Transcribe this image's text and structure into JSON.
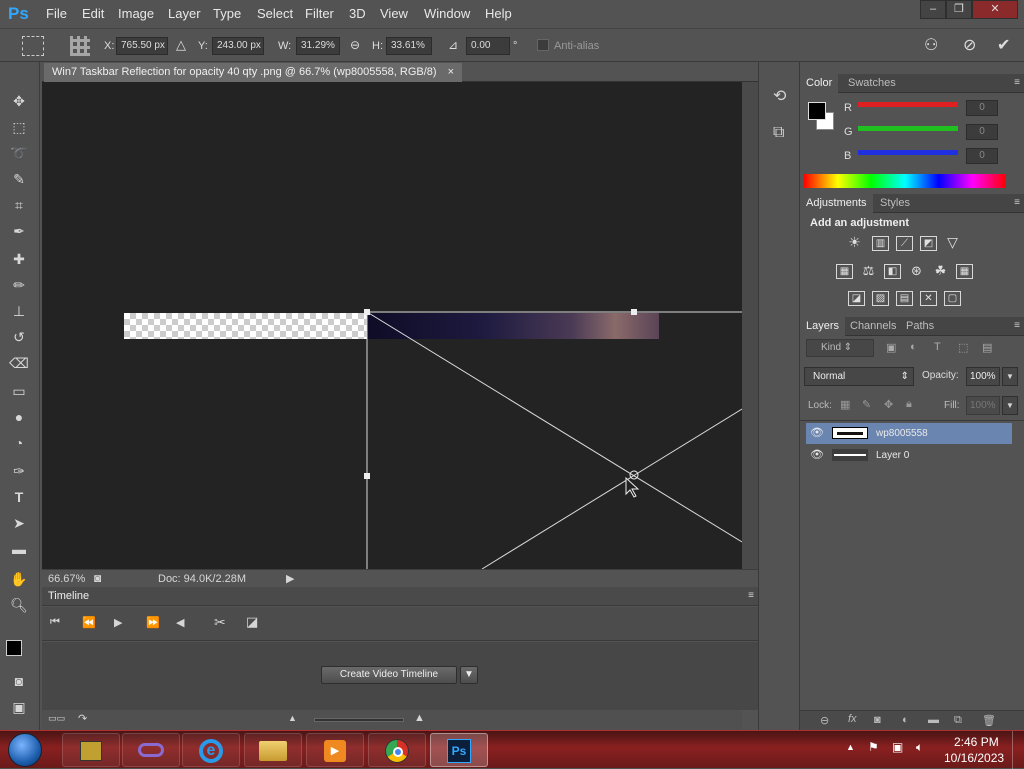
{
  "app": {
    "logo": "Ps"
  },
  "menu": [
    "File",
    "Edit",
    "Image",
    "Layer",
    "Type",
    "Select",
    "Filter",
    "3D",
    "View",
    "Window",
    "Help"
  ],
  "window_controls": {
    "minimize": "–",
    "restore": "❐",
    "close": "✕"
  },
  "options": {
    "x_label": "X:",
    "x_value": "765.50 px",
    "y_label": "Y:",
    "y_value": "243.00 px",
    "w_label": "W:",
    "w_value": "31.29%",
    "h_label": "H:",
    "h_value": "33.61%",
    "angle_value": "0.00",
    "angle_unit": "°",
    "antialias_label": "Anti-alias"
  },
  "document": {
    "tab_title": "Win7 Taskbar Reflection  for opacity 40 qty .png @ 66.7% (wp8005558, RGB/8)",
    "tab_close": "×"
  },
  "status": {
    "zoom": "66.67%",
    "doc": "Doc: 94.0K/2.28M"
  },
  "timeline": {
    "title": "Timeline",
    "create_button": "Create Video Timeline"
  },
  "color_panel": {
    "tabs": [
      "Color",
      "Swatches"
    ],
    "r_label": "R",
    "g_label": "G",
    "b_label": "B",
    "r_value": "0",
    "g_value": "0",
    "b_value": "0",
    "r_color": "#e02020",
    "g_color": "#20c020",
    "b_color": "#2030e0"
  },
  "adjustments_panel": {
    "tabs": [
      "Adjustments",
      "Styles"
    ],
    "heading": "Add an adjustment"
  },
  "layers_panel": {
    "tabs": [
      "Layers",
      "Channels",
      "Paths"
    ],
    "kind": "Kind",
    "blend_mode": "Normal",
    "opacity_label": "Opacity:",
    "opacity_value": "100%",
    "lock_label": "Lock:",
    "fill_label": "Fill:",
    "fill_value": "100%",
    "layers": [
      {
        "name": "wp8005558",
        "selected": true
      },
      {
        "name": "Layer 0",
        "selected": false
      }
    ]
  },
  "taskbar": {
    "time": "2:46 PM",
    "date": "10/16/2023"
  }
}
